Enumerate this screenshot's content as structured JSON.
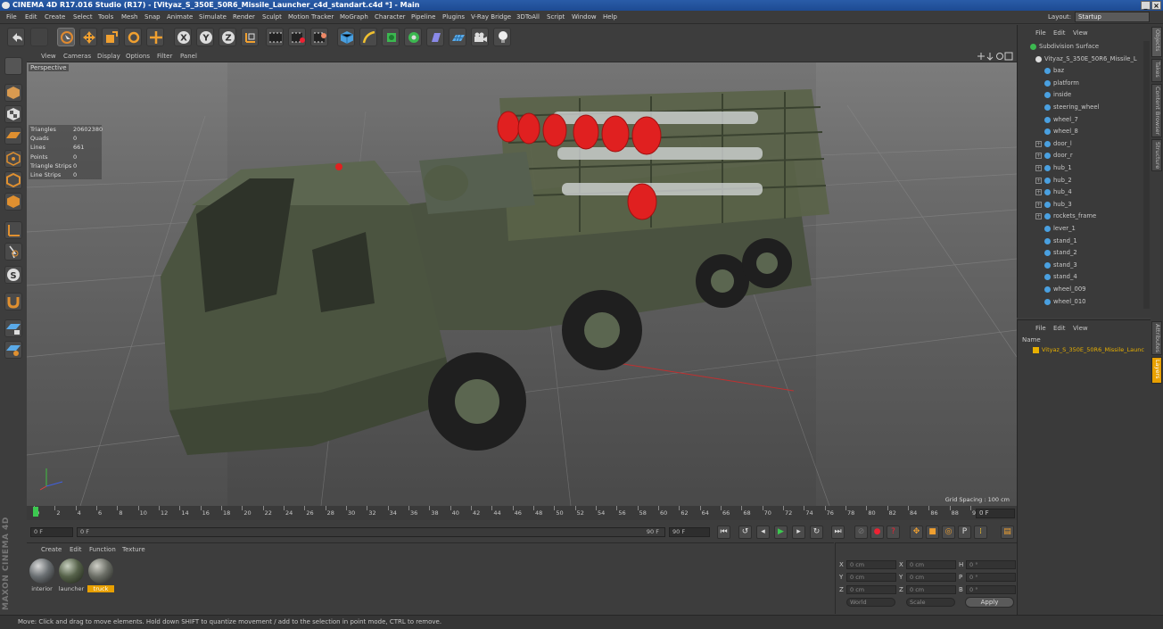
{
  "window": {
    "title": "CINEMA 4D R17.016 Studio (R17) - [Vityaz_S_350E_50R6_Missile_Launcher_c4d_standart.c4d *] - Main",
    "buttons": [
      "_",
      "×"
    ]
  },
  "menu": [
    "File",
    "Edit",
    "Create",
    "Select",
    "Tools",
    "Mesh",
    "Snap",
    "Animate",
    "Simulate",
    "Render",
    "Sculpt",
    "Motion Tracker",
    "MoGraph",
    "Character",
    "Pipeline",
    "Plugins",
    "V-Ray Bridge",
    "3DToAll",
    "Script",
    "Window",
    "Help"
  ],
  "layout": {
    "label": "Layout:",
    "value": "Startup"
  },
  "toolbar": {
    "axes": [
      "X",
      "Y",
      "Z"
    ]
  },
  "viewport": {
    "menu": [
      "View",
      "Cameras",
      "Display",
      "Options",
      "Filter",
      "Panel"
    ],
    "label": "Perspective",
    "stats": [
      {
        "k": "Triangles",
        "v": "20602380"
      },
      {
        "k": "Quads",
        "v": "0"
      },
      {
        "k": "Lines",
        "v": "661"
      },
      {
        "k": "Points",
        "v": "0"
      },
      {
        "k": "Triangle Strips",
        "v": "0"
      },
      {
        "k": "Line Strips",
        "v": "0"
      }
    ],
    "grid_spacing": "Grid Spacing : 100 cm"
  },
  "timeline": {
    "ticks": [
      "0",
      "2",
      "4",
      "6",
      "8",
      "10",
      "12",
      "14",
      "16",
      "18",
      "20",
      "22",
      "24",
      "26",
      "28",
      "30",
      "32",
      "34",
      "36",
      "38",
      "40",
      "42",
      "44",
      "46",
      "48",
      "50",
      "52",
      "54",
      "56",
      "58",
      "60",
      "62",
      "64",
      "66",
      "68",
      "70",
      "72",
      "74",
      "76",
      "78",
      "80",
      "82",
      "84",
      "86",
      "88",
      "90"
    ],
    "frame": "0 F",
    "end_label": "90 F"
  },
  "transport": {
    "start": "0 F",
    "cur": "0 F",
    "end": "90 F",
    "end2": "90 F"
  },
  "materials": {
    "menu": [
      "Create",
      "Edit",
      "Function",
      "Texture"
    ],
    "items": [
      {
        "name": "interior",
        "color": "#6a6f72"
      },
      {
        "name": "launcher",
        "color": "#56624a"
      },
      {
        "name": "truck",
        "color": "#6b6e66",
        "selected": true
      }
    ]
  },
  "coords": {
    "rows": [
      {
        "a": "X",
        "av": "0 cm",
        "b": "X",
        "bv": "0 cm",
        "c": "H",
        "cv": "0 °"
      },
      {
        "a": "Y",
        "av": "0 cm",
        "b": "Y",
        "bv": "0 cm",
        "c": "P",
        "cv": "0 °"
      },
      {
        "a": "Z",
        "av": "0 cm",
        "b": "Z",
        "bv": "0 cm",
        "c": "B",
        "cv": "0 °"
      }
    ],
    "world": "World",
    "scale": "Scale",
    "apply": "Apply"
  },
  "brand": {
    "line1": "MAXON",
    "line2": "CINEMA 4D"
  },
  "objects": {
    "menu": [
      "File",
      "Edit",
      "View"
    ],
    "items": [
      {
        "name": "Subdivision Surface",
        "level": 0
      },
      {
        "name": "Vityaz_S_350E_50R6_Missile_L",
        "level": 1
      },
      {
        "name": "baz",
        "level": 2
      },
      {
        "name": "platform",
        "level": 2
      },
      {
        "name": "inside",
        "level": 2
      },
      {
        "name": "steering_wheel",
        "level": 2
      },
      {
        "name": "wheel_7",
        "level": 2
      },
      {
        "name": "wheel_8",
        "level": 2
      },
      {
        "name": "door_l",
        "level": 2,
        "plus": true
      },
      {
        "name": "door_r",
        "level": 2,
        "plus": true
      },
      {
        "name": "hub_1",
        "level": 2,
        "plus": true
      },
      {
        "name": "hub_2",
        "level": 2,
        "plus": true
      },
      {
        "name": "hub_4",
        "level": 2,
        "plus": true
      },
      {
        "name": "hub_3",
        "level": 2,
        "plus": true
      },
      {
        "name": "rockets_frame",
        "level": 2,
        "plus": true
      },
      {
        "name": "lever_1",
        "level": 2
      },
      {
        "name": "stand_1",
        "level": 2
      },
      {
        "name": "stand_2",
        "level": 2
      },
      {
        "name": "stand_3",
        "level": 2
      },
      {
        "name": "stand_4",
        "level": 2
      },
      {
        "name": "wheel_009",
        "level": 2
      },
      {
        "name": "wheel_010",
        "level": 2
      }
    ]
  },
  "layers": {
    "menu": [
      "File",
      "Edit",
      "View"
    ],
    "col": "Name",
    "item": "Vityaz_S_350E_50R6_Missile_Launc",
    "color": "#e8c000"
  },
  "side_tabs": [
    "Objects",
    "Takes",
    "Content Browser",
    "Structure"
  ],
  "side_tabs2": [
    "Attributes",
    "Layers"
  ],
  "status": "Move: Click and drag to move elements. Hold down SHIFT to quantize movement / add to the selection in point mode, CTRL to remove."
}
